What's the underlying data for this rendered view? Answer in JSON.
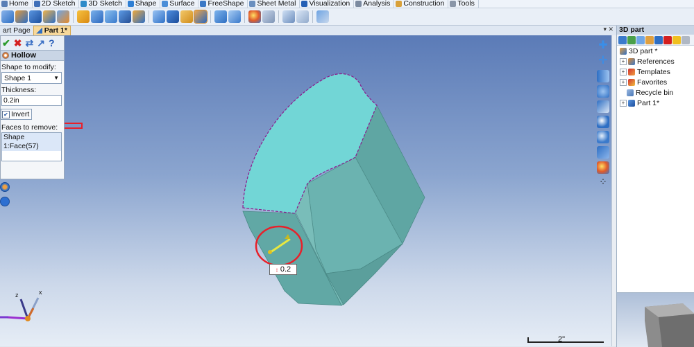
{
  "menubar": {
    "tabs": [
      {
        "label": "Home",
        "icon": "home-icon"
      },
      {
        "label": "2D Sketch",
        "icon": "sketch-2d-icon"
      },
      {
        "label": "3D Sketch",
        "icon": "sketch-3d-icon"
      },
      {
        "label": "Shape",
        "icon": "shape-icon"
      },
      {
        "label": "Surface",
        "icon": "surface-icon"
      },
      {
        "label": "FreeShape",
        "icon": "freeshape-icon"
      },
      {
        "label": "Sheet Metal",
        "icon": "sheet-metal-icon"
      },
      {
        "label": "Visualization",
        "icon": "visualization-icon"
      },
      {
        "label": "Analysis",
        "icon": "analysis-icon"
      },
      {
        "label": "Construction",
        "icon": "construction-icon"
      },
      {
        "label": "Tools",
        "icon": "tools-icon"
      }
    ]
  },
  "doc_tabs": {
    "start_page": "art Page",
    "part": "Part 1*"
  },
  "hollow_panel": {
    "title": "Hollow",
    "shape_label": "Shape to modify:",
    "shape_value": "Shape 1",
    "thickness_label": "Thickness:",
    "thickness_value": "0.2in",
    "invert_label": "Invert",
    "invert_checked": true,
    "faces_label": "Faces to remove:",
    "faces": [
      "Shape 1:Face(57)"
    ]
  },
  "viewport": {
    "dimension_label": "0.2",
    "scale_label": "2\"",
    "triad": {
      "z": "z",
      "x": "x"
    },
    "colors": {
      "model_top": "#72d6d6",
      "model_side": "#5fb0ac",
      "annotation": "#e8202a",
      "edge_highlight": "#8b1a8b"
    }
  },
  "tree": {
    "title": "3D part",
    "items": [
      {
        "label": "3D part *",
        "icon": "assembly-icon",
        "expandable": false
      },
      {
        "label": "References",
        "icon": "references-icon",
        "expandable": true
      },
      {
        "label": "Templates",
        "icon": "templates-icon",
        "expandable": true
      },
      {
        "label": "Favorites",
        "icon": "favorites-icon",
        "expandable": true
      },
      {
        "label": "Recycle bin",
        "icon": "recycle-bin-icon",
        "expandable": false
      },
      {
        "label": "Part 1*",
        "icon": "part-icon",
        "expandable": true
      }
    ]
  }
}
